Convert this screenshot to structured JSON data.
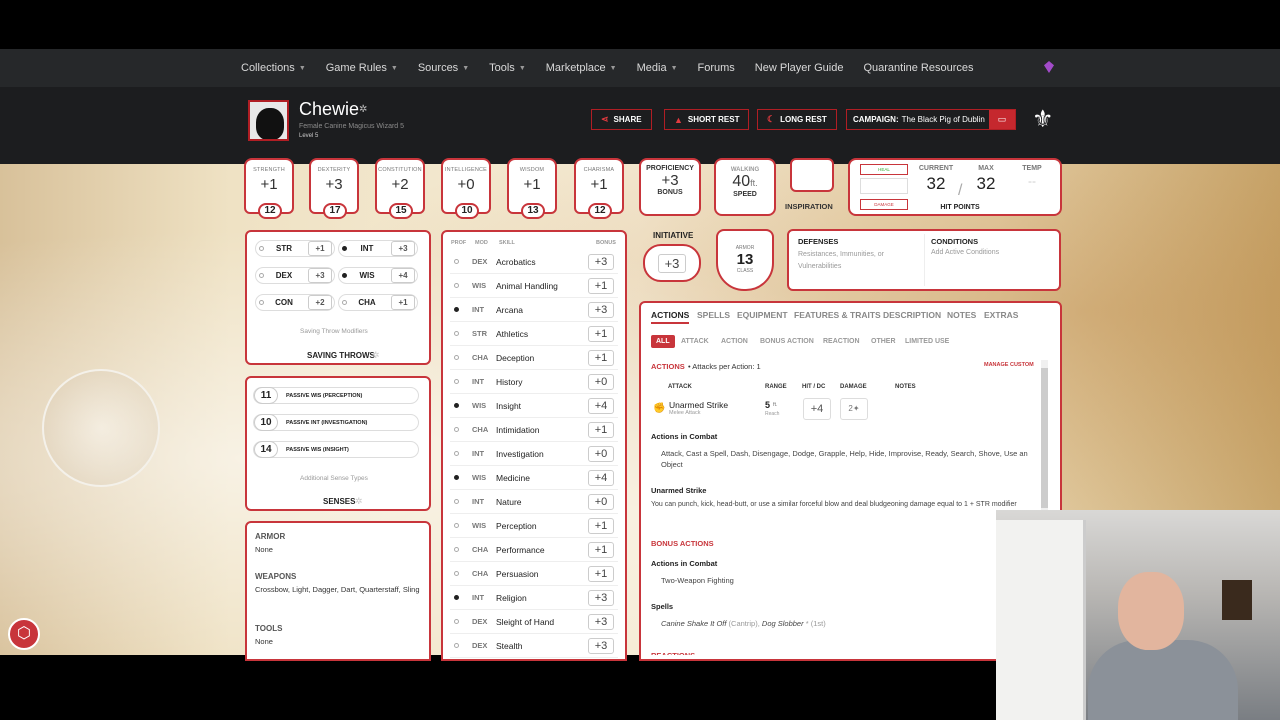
{
  "nav": {
    "items": [
      {
        "label": "Collections",
        "caret": true
      },
      {
        "label": "Game Rules",
        "caret": true
      },
      {
        "label": "Sources",
        "caret": true
      },
      {
        "label": "Tools",
        "caret": true
      },
      {
        "label": "Marketplace",
        "caret": true
      },
      {
        "label": "Media",
        "caret": true
      },
      {
        "label": "Forums",
        "caret": false
      },
      {
        "label": "New Player Guide",
        "caret": false
      },
      {
        "label": "Quarantine Resources",
        "caret": false
      }
    ]
  },
  "character": {
    "name": "Chewie",
    "subtitle": "Female  Canine Magicus  Wizard 5",
    "level": "Level 5"
  },
  "header_buttons": {
    "share": "SHARE",
    "short_rest": "SHORT REST",
    "long_rest": "LONG REST",
    "campaign_label": "CAMPAIGN:",
    "campaign_name": "The Black Pig of Dublin"
  },
  "abilities": [
    {
      "label": "STRENGTH",
      "mod": "+1",
      "score": "12"
    },
    {
      "label": "DEXTERITY",
      "mod": "+3",
      "score": "17"
    },
    {
      "label": "CONSTITUTION",
      "mod": "+2",
      "score": "15"
    },
    {
      "label": "INTELLIGENCE",
      "mod": "+0",
      "score": "10"
    },
    {
      "label": "WISDOM",
      "mod": "+1",
      "score": "13"
    },
    {
      "label": "CHARISMA",
      "mod": "+1",
      "score": "12"
    }
  ],
  "proficiency": {
    "label": "PROFICIENCY",
    "value": "+3",
    "sub": "BONUS"
  },
  "speed": {
    "label": "WALKING",
    "value": "40",
    "unit": "ft.",
    "sub": "SPEED"
  },
  "inspiration": {
    "label": "INSPIRATION"
  },
  "hit_points": {
    "heal": "HEAL",
    "damage": "DAMAGE",
    "current_label": "CURRENT",
    "current": "32",
    "max_label": "MAX",
    "max": "32",
    "temp_label": "TEMP",
    "temp": "--",
    "label": "HIT POINTS",
    "slash": "/"
  },
  "saving_throws": {
    "items": [
      {
        "label": "STR",
        "value": "+1",
        "proficient": false
      },
      {
        "label": "INT",
        "value": "+3",
        "proficient": true
      },
      {
        "label": "DEX",
        "value": "+3",
        "proficient": false
      },
      {
        "label": "WIS",
        "value": "+4",
        "proficient": true
      },
      {
        "label": "CON",
        "value": "+2",
        "proficient": false
      },
      {
        "label": "CHA",
        "value": "+1",
        "proficient": false
      }
    ],
    "modifiers": "Saving Throw Modifiers",
    "title": "SAVING THROWS"
  },
  "senses": {
    "passives": [
      {
        "value": "11",
        "label": "PASSIVE WIS (PERCEPTION)"
      },
      {
        "value": "10",
        "label": "PASSIVE INT (INVESTIGATION)"
      },
      {
        "value": "14",
        "label": "PASSIVE WIS (INSIGHT)"
      }
    ],
    "additional": "Additional Sense Types",
    "title": "SENSES"
  },
  "proficiencies": {
    "armor_label": "ARMOR",
    "armor": "None",
    "weapons_label": "WEAPONS",
    "weapons": "Crossbow, Light, Dagger, Dart, Quarterstaff, Sling",
    "tools_label": "TOOLS",
    "tools": "None"
  },
  "skills": {
    "headers": {
      "prof": "PROF",
      "mod": "MOD",
      "skill": "SKILL",
      "bonus": "BONUS"
    },
    "rows": [
      {
        "mod": "DEX",
        "name": "Acrobatics",
        "bonus": "+3",
        "proficient": false
      },
      {
        "mod": "WIS",
        "name": "Animal Handling",
        "bonus": "+1",
        "proficient": false
      },
      {
        "mod": "INT",
        "name": "Arcana",
        "bonus": "+3",
        "proficient": true
      },
      {
        "mod": "STR",
        "name": "Athletics",
        "bonus": "+1",
        "proficient": false
      },
      {
        "mod": "CHA",
        "name": "Deception",
        "bonus": "+1",
        "proficient": false
      },
      {
        "mod": "INT",
        "name": "History",
        "bonus": "+0",
        "proficient": false
      },
      {
        "mod": "WIS",
        "name": "Insight",
        "bonus": "+4",
        "proficient": true
      },
      {
        "mod": "CHA",
        "name": "Intimidation",
        "bonus": "+1",
        "proficient": false
      },
      {
        "mod": "INT",
        "name": "Investigation",
        "bonus": "+0",
        "proficient": false
      },
      {
        "mod": "WIS",
        "name": "Medicine",
        "bonus": "+4",
        "proficient": true
      },
      {
        "mod": "INT",
        "name": "Nature",
        "bonus": "+0",
        "proficient": false
      },
      {
        "mod": "WIS",
        "name": "Perception",
        "bonus": "+1",
        "proficient": false
      },
      {
        "mod": "CHA",
        "name": "Performance",
        "bonus": "+1",
        "proficient": false
      },
      {
        "mod": "CHA",
        "name": "Persuasion",
        "bonus": "+1",
        "proficient": false
      },
      {
        "mod": "INT",
        "name": "Religion",
        "bonus": "+3",
        "proficient": true
      },
      {
        "mod": "DEX",
        "name": "Sleight of Hand",
        "bonus": "+3",
        "proficient": false
      },
      {
        "mod": "DEX",
        "name": "Stealth",
        "bonus": "+3",
        "proficient": false
      }
    ]
  },
  "initiative": {
    "label": "INITIATIVE",
    "value": "+3"
  },
  "armor_class": {
    "top": "ARMOR",
    "value": "13",
    "bottom": "CLASS"
  },
  "defenses": {
    "title": "DEFENSES",
    "text": "Resistances, Immunities, or Vulnerabilities"
  },
  "conditions": {
    "title": "CONDITIONS",
    "text": "Add Active Conditions"
  },
  "tabs": [
    "ACTIONS",
    "SPELLS",
    "EQUIPMENT",
    "FEATURES & TRAITS",
    "DESCRIPTION",
    "NOTES",
    "EXTRAS"
  ],
  "filters": [
    "ALL",
    "ATTACK",
    "ACTION",
    "BONUS ACTION",
    "REACTION",
    "OTHER",
    "LIMITED USE"
  ],
  "actions": {
    "title": "ACTIONS",
    "attacks_per": "• Attacks per Action: 1",
    "manage": "MANAGE CUSTOM",
    "col_attack": "ATTACK",
    "col_range": "RANGE",
    "col_hit": "HIT / DC",
    "col_damage": "DAMAGE",
    "col_notes": "NOTES",
    "attack_name": "Unarmed Strike",
    "attack_type": "Melee Attack",
    "range": "5",
    "range_unit": "ft.",
    "range_sub": "Reach",
    "hit": "+4",
    "damage": "2",
    "in_combat_title": "Actions in Combat",
    "in_combat_text": "Attack, Cast a Spell, Dash, Disengage, Dodge, Grapple, Help, Hide, Improvise, Ready, Search, Shove, Use an Object",
    "unarmed_title": "Unarmed Strike",
    "unarmed_text": "You can punch, kick, head-butt, or use a similar forceful blow and deal bludgeoning damage equal to 1 + STR modifier"
  },
  "bonus_actions": {
    "title": "BONUS ACTIONS",
    "in_combat_title": "Actions in Combat",
    "in_combat_text": "Two-Weapon Fighting",
    "spells_title": "Spells",
    "spell1": "Canine Shake It Off",
    "spell1_note": "(Cantrip),",
    "spell2": "Dog Slobber",
    "spell2_note": "* (1st)",
    "reactions_title": "REACTIONS"
  }
}
